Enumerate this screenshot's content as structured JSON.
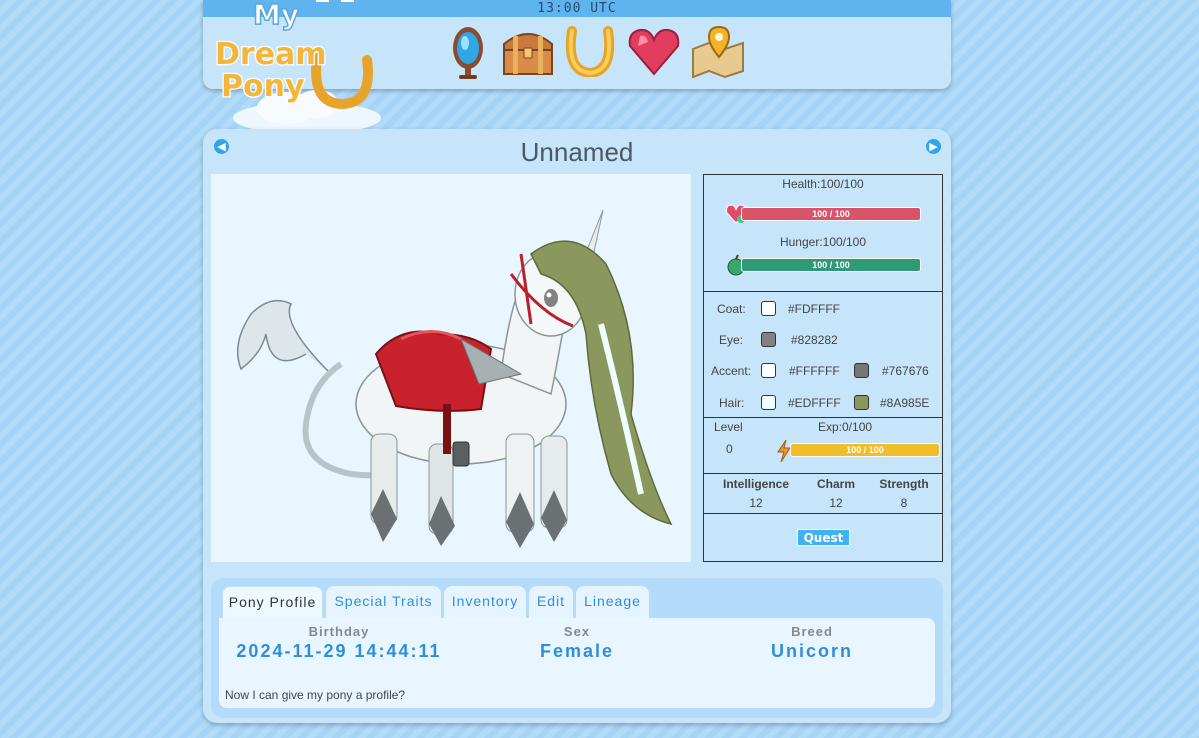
{
  "header": {
    "time": "13:00 UTC",
    "logo_text": "My Dream Pony",
    "nav": [
      {
        "name": "mirror-icon"
      },
      {
        "name": "treasure-chest-icon"
      },
      {
        "name": "horseshoe-icon"
      },
      {
        "name": "heart-gem-icon"
      },
      {
        "name": "map-icon"
      }
    ]
  },
  "pony": {
    "name": "Unnamed",
    "health_label": "Health:100/100",
    "health_value": "100 / 100",
    "health_fraction": 1.0,
    "hunger_label": "Hunger:100/100",
    "hunger_value": "100 / 100",
    "hunger_fraction": 1.0,
    "colors": {
      "coat_label": "Coat:",
      "coat": "#FDFFFF",
      "eye_label": "Eye:",
      "eye": "#828282",
      "accent_label": "Accent:",
      "accent1": "#FFFFFF",
      "accent2": "#767676",
      "hair_label": "Hair:",
      "hair1": "#EDFFFF",
      "hair2": "#8A985E"
    },
    "level_label": "Level",
    "level": "0",
    "exp_label": "Exp:0/100",
    "exp_value": "100 / 100",
    "exp_fraction": 1.0,
    "attributes": [
      {
        "label": "Intelligence",
        "value": "12"
      },
      {
        "label": "Charm",
        "value": "12"
      },
      {
        "label": "Strength",
        "value": "8"
      }
    ],
    "quest_label": "Quest"
  },
  "tabs": [
    "Pony Profile",
    "Special Traits",
    "Inventory",
    "Edit",
    "Lineage"
  ],
  "profile": {
    "birthday_label": "Birthday",
    "birthday": "2024-11-29 14:44:11",
    "sex_label": "Sex",
    "sex": "Female",
    "breed_label": "Breed",
    "breed": "Unicorn",
    "description": "Now I can give my pony a profile?"
  },
  "colors": {
    "health_bar": "#d9546a",
    "hunger_bar": "#2f9a78",
    "exp_bar": "#f0be2c",
    "accent_blue": "#2e8fd8"
  }
}
